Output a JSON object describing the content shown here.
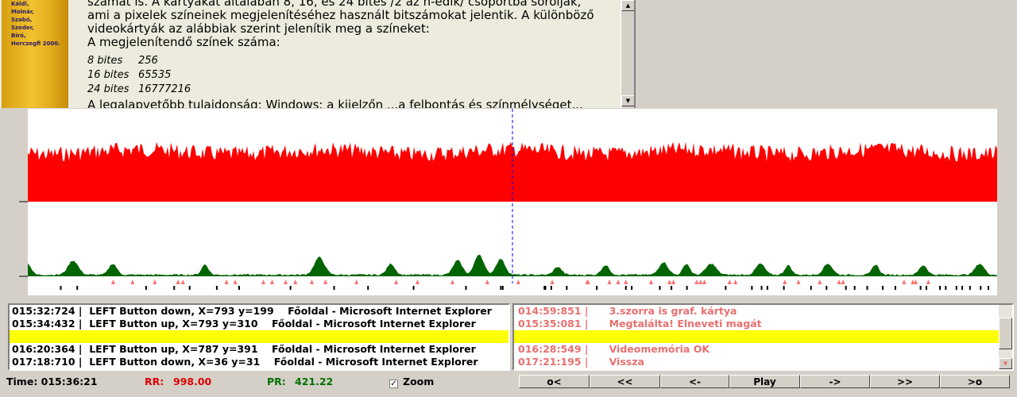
{
  "document": {
    "book_authors": [
      "Káldi,",
      "Molnár,",
      "Szabó,",
      "Szeder,",
      "Bíró,",
      "Herczegfi 2000."
    ],
    "paragraph_lines": [
      "számát is. A kártyákat általában 8, 16, és 24 bites /2 az n-edik/ csoportba sorolják,",
      "ami a pixelek színeinek megjelenítéséhez használt bitszámokat jelentik. A különböző",
      "videokártyák az alábbiak szerint jelenítik meg a színeket:",
      "A megjelenítendő színek száma:"
    ],
    "bit_rows": [
      {
        "bits": "8 bites",
        "colors": "256"
      },
      {
        "bits": "16 bites",
        "colors": "65535"
      },
      {
        "bits": "24 bites",
        "colors": "16777216"
      }
    ],
    "cut_line": "A legalapvetőbb tulajdonság: Windows: a kijelzőn ...a felbontás és színmélységet..."
  },
  "graph": {
    "top_series_color": "#ff0000",
    "bottom_series_color": "#006400",
    "cursor_color": "#0000ff",
    "marker_color": "#ff7070",
    "event_color": "#000000",
    "cursor_fraction": 0.5,
    "red_marker_fractions": [
      0.088,
      0.108,
      0.131,
      0.155,
      0.16,
      0.205,
      0.214,
      0.243,
      0.252,
      0.266,
      0.276,
      0.293,
      0.307,
      0.339,
      0.38,
      0.402,
      0.438,
      0.474,
      0.506,
      0.541,
      0.577,
      0.578,
      0.6,
      0.609,
      0.617,
      0.643,
      0.662,
      0.666,
      0.69,
      0.694,
      0.698,
      0.724,
      0.73,
      0.781,
      0.795,
      0.817,
      0.837,
      0.841,
      0.904,
      0.913,
      0.916,
      0.929
    ],
    "black_marker_fractions": [
      0.034,
      0.051,
      0.122,
      0.151,
      0.167,
      0.195,
      0.218,
      0.271,
      0.316,
      0.351,
      0.398,
      0.452,
      0.488,
      0.49,
      0.533,
      0.534,
      0.54,
      0.556,
      0.587,
      0.617,
      0.623,
      0.652,
      0.664,
      0.68,
      0.72,
      0.747,
      0.757,
      0.763,
      0.78,
      0.808,
      0.824,
      0.844,
      0.853,
      0.866,
      0.882,
      0.895,
      0.921,
      0.927,
      0.941,
      0.947,
      0.958,
      0.964,
      0.972,
      0.983,
      0.991
    ]
  },
  "left_log": [
    "015:32:724 |  LEFT Button down, X=793 y=199    Főoldal - Microsoft Internet Explorer",
    "015:34:432 |  LEFT Button up, X=793 y=310    Főoldal - Microsoft Internet Explorer",
    "",
    "016:20:364 |  LEFT Button up, X=787 y=391    Főoldal - Microsoft Internet Explorer",
    "017:18:710 |  LEFT Button down, X=36 y=31    Főoldal - Microsoft Internet Explorer"
  ],
  "right_log": [
    "014:59:851 |      3.szorra is graf. kártya",
    "015:35:081 |      Megtalálta! Elneveti magát",
    "",
    "016:28:549 |      Videomemória OK",
    "017:21:195 |      Vissza"
  ],
  "status": {
    "time_label": "Time: 015:36:21",
    "rr_label": "RR:",
    "rr_value": "998.00",
    "pr_label": "PR:",
    "pr_value": "421.22",
    "zoom_label": "Zoom",
    "zoom_checked": true
  },
  "nav": {
    "first": "o<",
    "fast_back": "<<",
    "back": "<-",
    "play": "Play",
    "forward": "->",
    "fast_forward": ">>",
    "last": ">o"
  }
}
